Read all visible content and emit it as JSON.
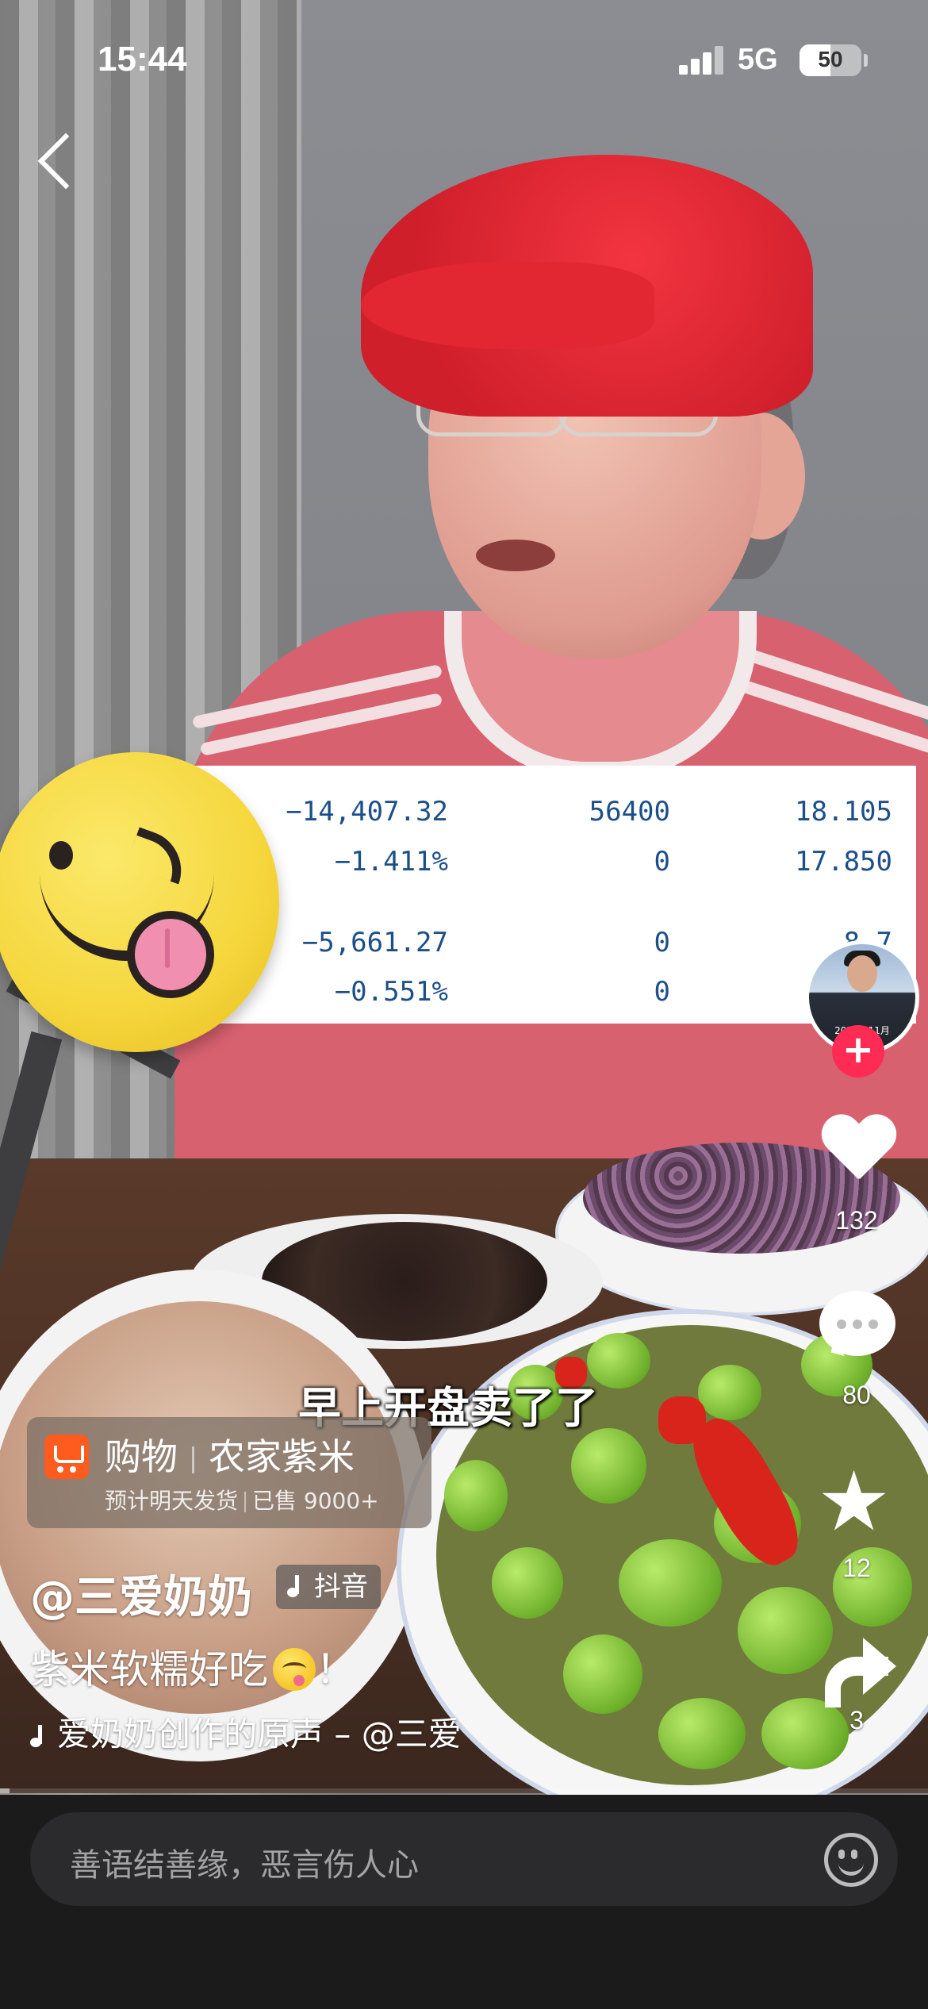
{
  "status_bar": {
    "time": "15:44",
    "network": "5G",
    "battery": "50",
    "battery_level": 0.5
  },
  "video": {
    "subtitle": "早上开盘卖了了",
    "overlay_table": {
      "rows": [
        [
          "−14,407.32",
          "56400",
          "18.105"
        ],
        [
          "−1.411%",
          "0",
          "17.850"
        ],
        [
          "−5,661.27",
          "0",
          "8.7"
        ],
        [
          "−0.551%",
          "0",
          ""
        ]
      ]
    },
    "progress": 0.01
  },
  "right_rail": {
    "avatar_caption": "2025年11月",
    "follow_symbol": "+",
    "like_count": "132",
    "comment_count": "80",
    "favorite_count": "12",
    "share_count": "3",
    "icons": [
      "heart-icon",
      "comment-icon",
      "star-icon",
      "share-icon"
    ]
  },
  "shopping": {
    "label": "购物",
    "product": "农家紫米",
    "shipping": "预计明天发货",
    "sold": "已售 9000+"
  },
  "post": {
    "author": "@三爱奶奶",
    "platform_badge": "抖音",
    "description": "紫米软糯好吃",
    "description_suffix": "！",
    "music": "爱奶奶创作的原声 – @三爱"
  },
  "comment_bar": {
    "placeholder": "善语结善缘，恶言伤人心"
  },
  "colors": {
    "follow": "#fe2c55",
    "cart": "#fe5b1f",
    "table_text": "#1c4f8a"
  }
}
